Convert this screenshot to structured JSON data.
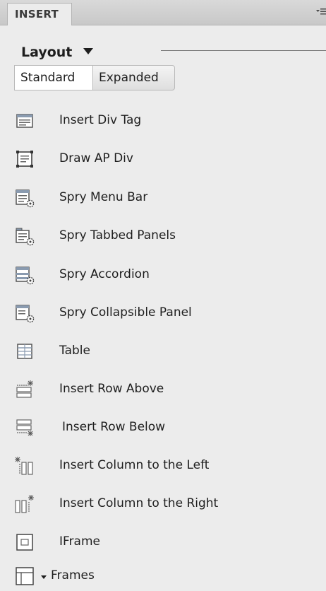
{
  "panel": {
    "tab_label": "INSERT",
    "menu_icon": "panel-options-icon"
  },
  "category": {
    "label": "Layout",
    "arrow_icon": "chevron-down-icon"
  },
  "mode_toggle": {
    "standard": "Standard",
    "expanded": "Expanded",
    "active": "Standard"
  },
  "items": [
    {
      "label": "Insert Div Tag",
      "icon": "div-tag-icon"
    },
    {
      "label": "Draw AP Div",
      "icon": "ap-div-icon"
    },
    {
      "label": "Spry Menu Bar",
      "icon": "spry-menu-bar-icon"
    },
    {
      "label": "Spry Tabbed Panels",
      "icon": "spry-tabbed-panels-icon"
    },
    {
      "label": "Spry Accordion",
      "icon": "spry-accordion-icon"
    },
    {
      "label": "Spry Collapsible Panel",
      "icon": "spry-collapsible-panel-icon"
    },
    {
      "label": "Table",
      "icon": "table-icon"
    },
    {
      "label": "Insert Row Above",
      "icon": "row-above-icon"
    },
    {
      "label": "Insert Row Below",
      "icon": "row-below-icon"
    },
    {
      "label": "Insert Column to the Left",
      "icon": "column-left-icon"
    },
    {
      "label": "Insert Column to the Right",
      "icon": "column-right-icon"
    },
    {
      "label": "IFrame",
      "icon": "iframe-icon"
    },
    {
      "label": "Frames",
      "icon": "frames-icon"
    }
  ]
}
